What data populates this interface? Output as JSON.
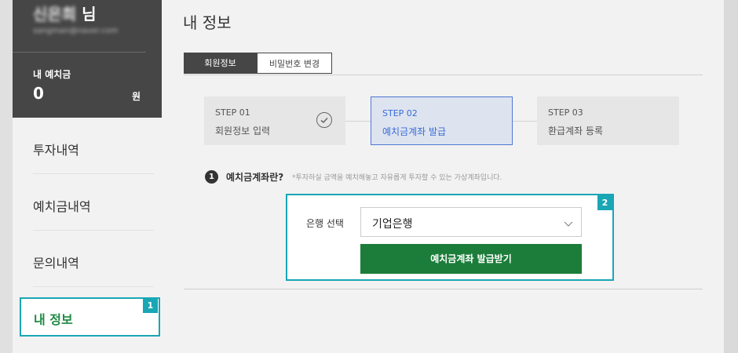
{
  "sidebar": {
    "user_name_masked": "신은희",
    "user_suffix": "님",
    "user_email_masked": "sangman@naver.com",
    "deposit_label": "내 예치금",
    "deposit_value": "0",
    "deposit_unit": "원",
    "menu": [
      "투자내역",
      "예치금내역",
      "문의내역",
      "내 정보"
    ],
    "active_badge": "1"
  },
  "main": {
    "title": "내 정보",
    "tabs": [
      {
        "label": "회원정보",
        "active": true
      },
      {
        "label": "비밀번호 변경",
        "active": false
      }
    ],
    "steps": [
      {
        "num": "STEP 01",
        "title": "회원정보 입력",
        "status": "done",
        "icon": "check-circle-icon"
      },
      {
        "num": "STEP 02",
        "title": "예치금계좌 발급",
        "status": "current"
      },
      {
        "num": "STEP 03",
        "title": "환급계좌 등록",
        "status": "pending"
      }
    ],
    "info": {
      "number": "1",
      "title": "예치금계좌란?",
      "desc": "*투자하실 금액을 예치해놓고 자유롭게 투자할 수 있는 가상계좌입니다."
    },
    "form": {
      "badge": "2",
      "bank_label": "은행 선택",
      "bank_value": "기업은행",
      "issue_button": "예치금계좌 발급받기"
    }
  },
  "colors": {
    "accent": "#19a6b5",
    "primary_green": "#1c7d3a",
    "step_active": "#3b6bd6",
    "dark": "#464646"
  }
}
